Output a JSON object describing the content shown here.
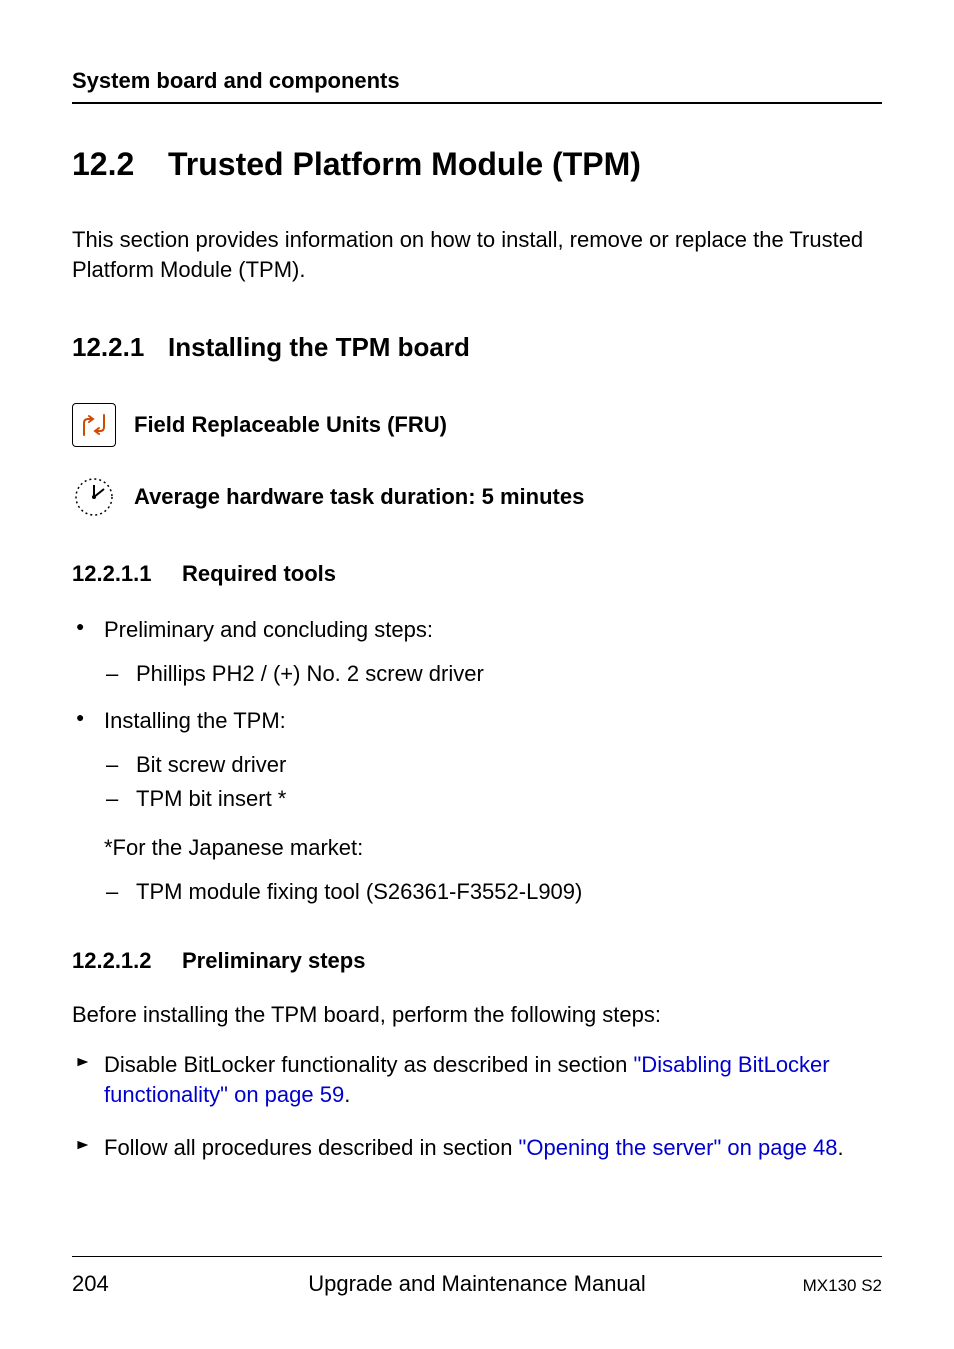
{
  "header": {
    "running_title": "System board and components"
  },
  "section": {
    "number": "12.2",
    "title": "Trusted Platform Module (TPM)",
    "intro": "This section provides information on how to install, remove or replace the Trusted Platform Module (TPM)."
  },
  "subsection": {
    "number": "12.2.1",
    "title": "Installing the TPM board"
  },
  "fru": {
    "label": "Field Replaceable Units (FRU)"
  },
  "duration": {
    "label": "Average hardware task duration: 5 minutes"
  },
  "s12211": {
    "number": "12.2.1.1",
    "title": "Required tools",
    "bullets": [
      {
        "text": "Preliminary and concluding steps:",
        "dashes": [
          "Phillips PH2 / (+) No. 2 screw driver"
        ]
      },
      {
        "text": " Installing the TPM:",
        "dashes": [
          "Bit screw driver",
          "TPM bit insert *"
        ],
        "note": "*For the Japanese market:",
        "after_dashes": [
          "TPM module fixing tool (S26361-F3552-L909)"
        ]
      }
    ]
  },
  "s12212": {
    "number": "12.2.1.2",
    "title": "Preliminary steps",
    "intro": "Before installing the TPM board, perform the following steps:",
    "steps": [
      {
        "pre": "Disable BitLocker functionality as described in section ",
        "link": "\"Disabling BitLocker functionality\" on page 59",
        "post": "."
      },
      {
        "pre": "Follow all procedures described in section ",
        "link": "\"Opening the server\" on page 48",
        "post": "."
      }
    ]
  },
  "footer": {
    "page": "204",
    "center": "Upgrade and Maintenance Manual",
    "right": "MX130 S2"
  }
}
